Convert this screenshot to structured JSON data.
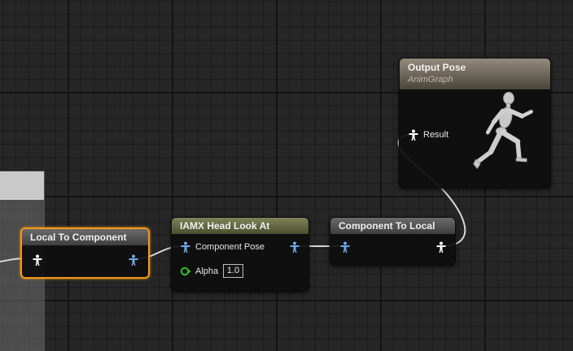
{
  "nodes": {
    "local_to_component": {
      "title": "Local To Component",
      "header_color": "#5a5a5a",
      "selected": true
    },
    "head_look_at": {
      "title": "IAMX Head Look At",
      "header_color": "#6b7047",
      "pins": {
        "component_pose": "Component Pose",
        "alpha": "Alpha"
      },
      "alpha_value": "1.0"
    },
    "component_to_local": {
      "title": "Component To Local",
      "header_color": "#5a5a5a"
    },
    "output_pose": {
      "title": "Output Pose",
      "subtitle": "AnimGraph",
      "header_color": "#857e70",
      "pins": {
        "result": "Result"
      }
    }
  },
  "colors": {
    "selection_outline": "#f39a1a",
    "local_pose_pin": "#ffffff",
    "component_pose_pin": "#6fa8e8",
    "float_pin": "#35c12a",
    "wire": "#d8d8d8"
  },
  "icons": {
    "local_pose": "person-white-icon",
    "component_pose": "person-blue-icon",
    "float": "float-pin-icon",
    "output_preview": "running-mannequin-icon"
  }
}
